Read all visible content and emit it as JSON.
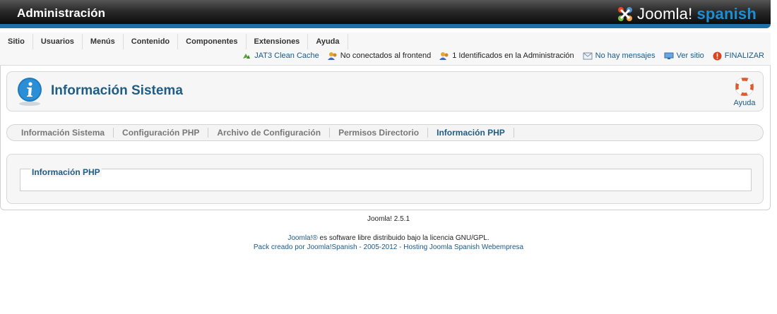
{
  "header": {
    "title": "Administración",
    "logo_joomla": "Joomla!",
    "logo_spanish": "spanish"
  },
  "menu": {
    "items": [
      "Sitio",
      "Usuarios",
      "Menús",
      "Contenido",
      "Componentes",
      "Extensiones",
      "Ayuda"
    ]
  },
  "status": {
    "cache": "JAT3 Clean Cache",
    "frontend": "No conectados al frontend",
    "admin": "1 Identificados en la Administración",
    "messages": "No hay mensajes",
    "view_site": "Ver sitio",
    "logout": "FINALIZAR"
  },
  "page": {
    "title": "Información Sistema",
    "help_label": "Ayuda"
  },
  "subnav": {
    "tabs": [
      "Información Sistema",
      "Configuración PHP",
      "Archivo de Configuración",
      "Permisos Directorio",
      "Información PHP"
    ],
    "active_index": 4
  },
  "content": {
    "legend": "Información PHP"
  },
  "footer": {
    "version": "Joomla! 2.5.1",
    "license_link": "Joomla!®",
    "license_text": " es software libre distribuido bajo la licencia GNU/GPL.",
    "pack": "Pack creado por Joomla!Spanish - 2005-2012 - Hosting Joomla Spanish Webempresa"
  },
  "colors": {
    "accent": "#1d6fa5",
    "title_blue": "#1f5d86",
    "link_blue": "#1a5a8a",
    "logo_blue": "#1b8ed6"
  }
}
